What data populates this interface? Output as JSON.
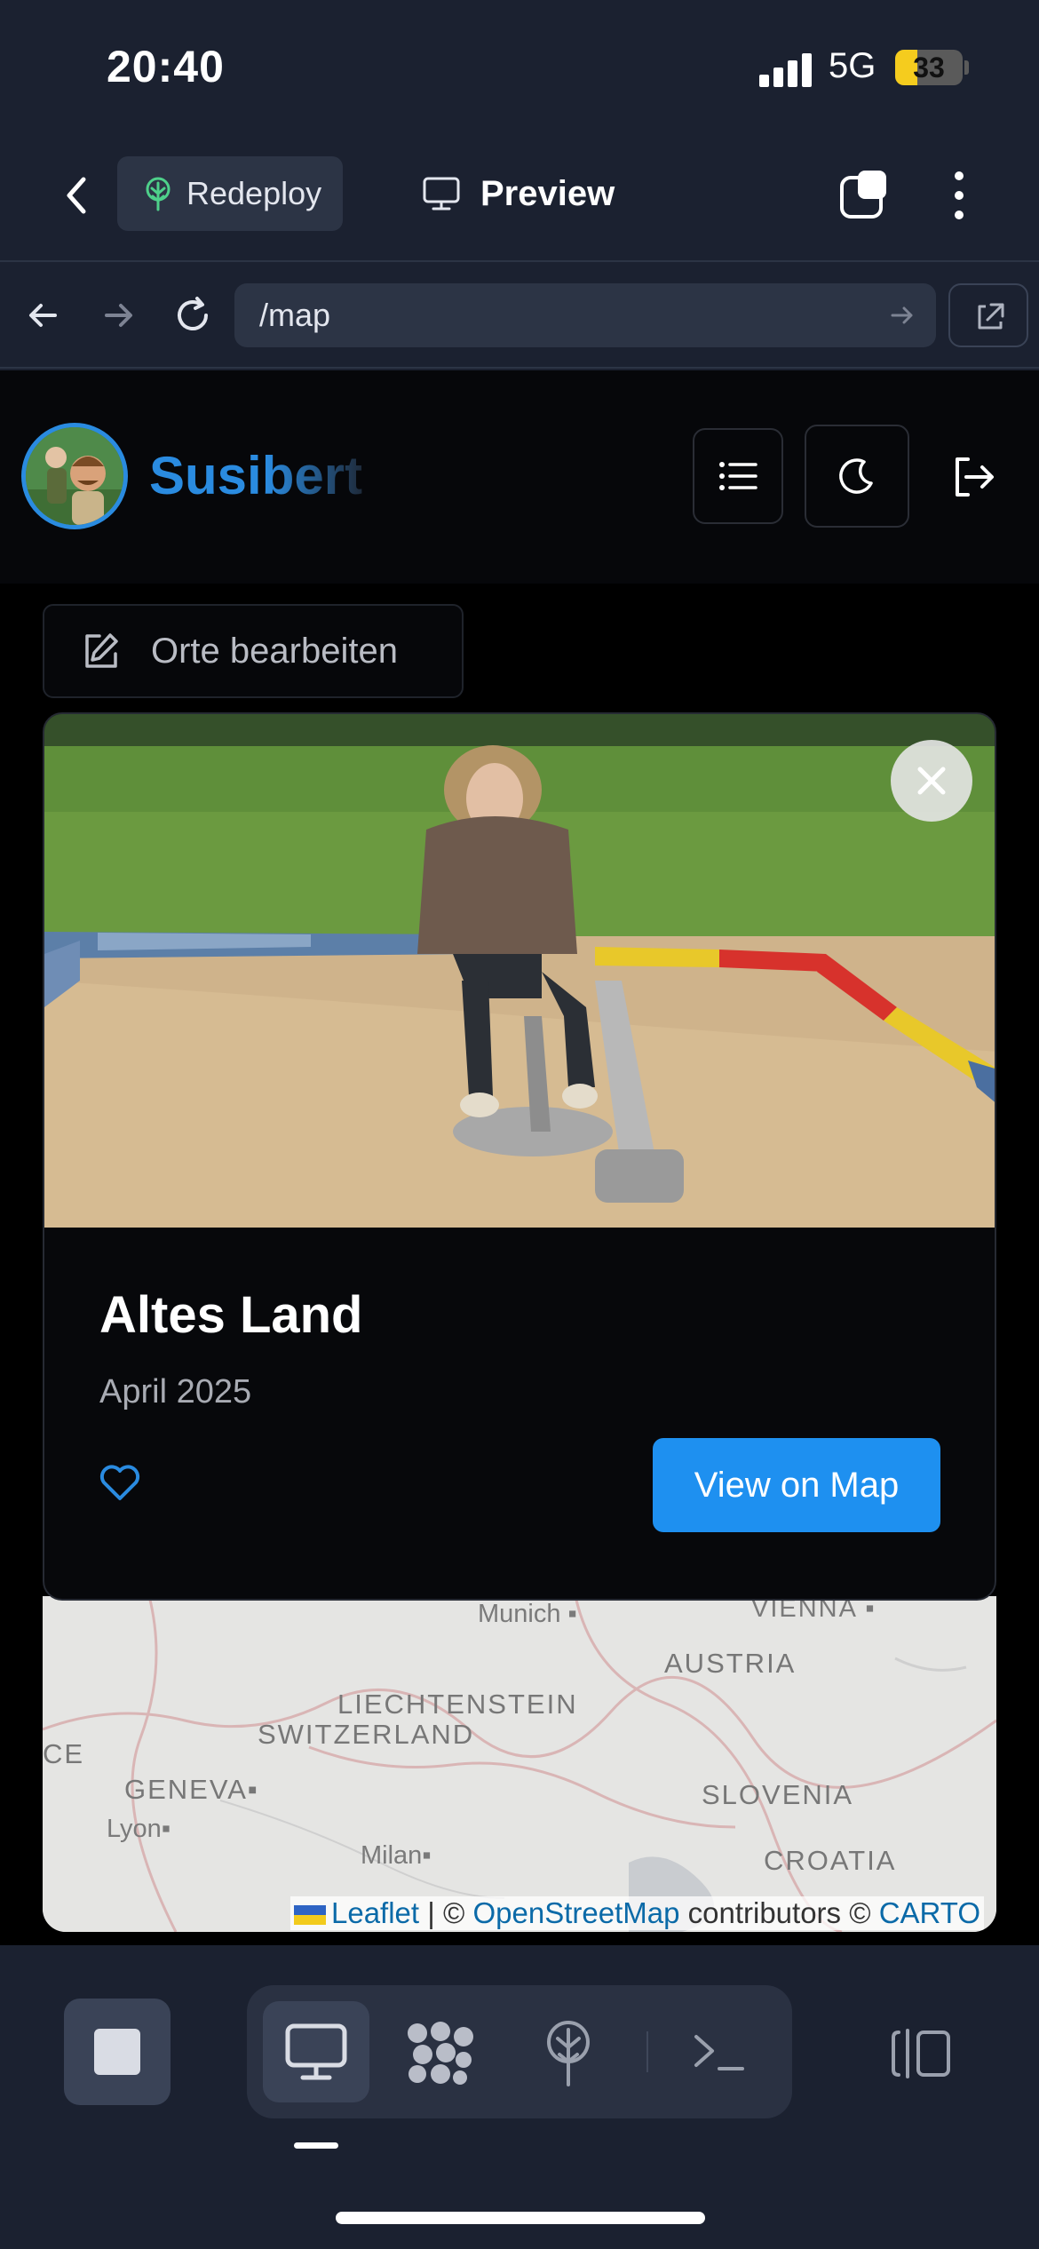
{
  "status_bar": {
    "time": "20:40",
    "network": "5G",
    "battery_percent": "33",
    "battery_level": 0.33
  },
  "app_toolbar": {
    "redeploy_label": "Redeploy",
    "preview_label": "Preview"
  },
  "browser": {
    "url": "/map"
  },
  "site": {
    "brand": "Susibert"
  },
  "edit_places_label": "Orte bearbeiten",
  "card": {
    "title": "Altes Land",
    "date": "April 2025",
    "view_button": "View on Map",
    "photo_alt": "Person on a sandpit digger in a playground"
  },
  "map": {
    "labels": {
      "munich": "Munich",
      "vienna": "VIENNA",
      "austria": "AUSTRIA",
      "liechtenstein": "LIECHTENSTEIN",
      "switzerland": "SWITZERLAND",
      "geneva": "GENEVA",
      "lyon": "Lyon",
      "slovenia": "SLOVENIA",
      "milan": "Milan",
      "croatia": "CROATIA",
      "france_partial": "CE"
    },
    "attribution": {
      "leaflet": "Leaflet",
      "sep": " | © ",
      "osm": "OpenStreetMap",
      "contrib": " contributors © ",
      "carto": "CARTO"
    }
  },
  "colors": {
    "accent": "#1e90f0",
    "chrome": "#1b2130",
    "page_bg": "#000000"
  },
  "icons": [
    "chevron-left-icon",
    "tree-icon",
    "monitor-icon",
    "tabs-icon",
    "more-vertical-icon",
    "arrow-left-icon",
    "arrow-right-icon",
    "reload-icon",
    "external-link-icon",
    "list-icon",
    "moon-icon",
    "logout-icon",
    "edit-icon",
    "close-icon",
    "heart-icon",
    "stop-icon",
    "grid-icon",
    "terminal-icon",
    "split-view-icon"
  ]
}
